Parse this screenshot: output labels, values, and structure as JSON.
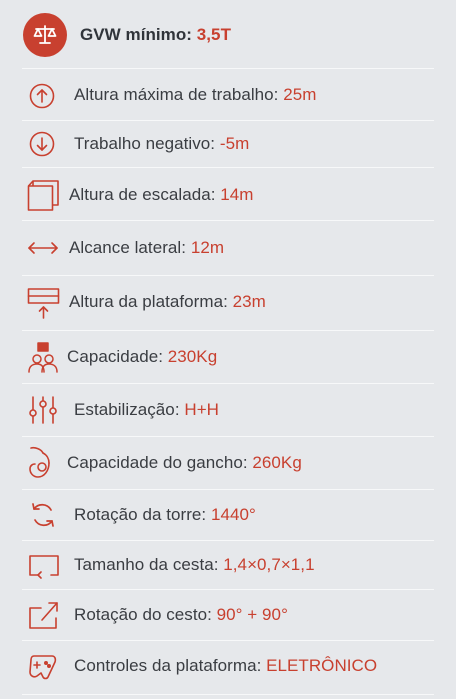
{
  "specs": [
    {
      "icon": "scale-icon",
      "label": "GVW mínimo:",
      "value": "3,5T"
    },
    {
      "icon": "arrow-up-circle-icon",
      "label": "Altura máxima de trabalho:",
      "value": "25m"
    },
    {
      "icon": "arrow-down-circle-icon",
      "label": "Trabalho negativo:",
      "value": "-5m"
    },
    {
      "icon": "climb-height-icon",
      "label": "Altura de escalada:",
      "value": "14m"
    },
    {
      "icon": "horizontal-arrows-icon",
      "label": "Alcance lateral:",
      "value": "12m"
    },
    {
      "icon": "platform-height-icon",
      "label": "Altura da plataforma:",
      "value": "23m"
    },
    {
      "icon": "people-capacity-icon",
      "label": "Capacidade:",
      "value": "230Kg"
    },
    {
      "icon": "stabilizer-sliders-icon",
      "label": "Estabilização:",
      "value": "H+H"
    },
    {
      "icon": "hook-icon",
      "label": "Capacidade do gancho:",
      "value": "260Kg"
    },
    {
      "icon": "rotation-icon",
      "label": "Rotação da torre:",
      "value": "1440°"
    },
    {
      "icon": "basket-size-icon",
      "label": "Tamanho da cesta:",
      "value": "1,4×0,7×1,1"
    },
    {
      "icon": "basket-rotation-icon",
      "label": "Rotação do cesto:",
      "value": "90° + 90°"
    },
    {
      "icon": "gamepad-icon",
      "label": "Controles da plataforma:",
      "value": "ELETRÔNICO"
    }
  ],
  "colors": {
    "accent": "#c8402f",
    "text": "#3a3d42",
    "background": "#e6e8eb"
  }
}
